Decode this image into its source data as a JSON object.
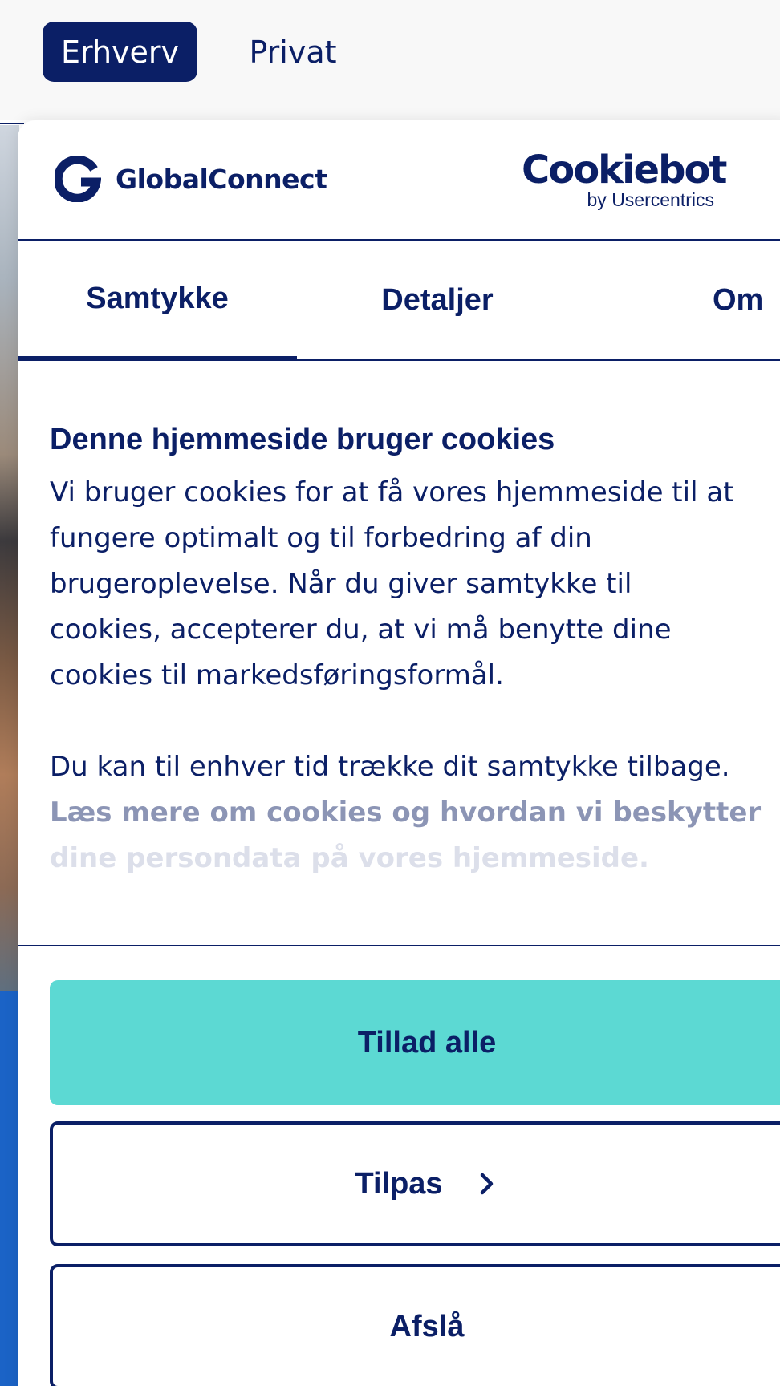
{
  "site_nav": {
    "segments": [
      {
        "label": "Erhverv",
        "active": true
      },
      {
        "label": "Privat",
        "active": false
      }
    ]
  },
  "dialog": {
    "brand_name": "GlobalConnect",
    "provider": {
      "name": "Cookiebot",
      "tagline": "by Usercentrics"
    },
    "tabs": [
      {
        "label": "Samtykke",
        "active": true
      },
      {
        "label": "Detaljer",
        "active": false
      },
      {
        "label": "Om",
        "active": false
      }
    ],
    "title": "Denne hjemmeside bruger cookies",
    "paragraph1_lines": [
      "Vi bruger cookies for at få vores hjemmeside til at",
      "fungere optimalt og til forbedring af din",
      "brugeroplevelse. Når du giver samtykke til",
      "cookies, accepterer du, at vi må benytte dine",
      "cookies til markedsføringsformål."
    ],
    "paragraph2_line": "Du kan til enhver tid trække dit samtykke tilbage.",
    "link_lines": [
      "Læs mere om cookies og hvordan vi beskytter",
      "dine persondata på vores hjemmeside."
    ],
    "buttons": {
      "allow_all": "Tillad alle",
      "customize": "Tilpas",
      "deny": "Afslå"
    }
  },
  "colors": {
    "brand_navy": "#0b1f66",
    "accent_teal": "#5cd9d3",
    "site_blue": "#1b63c6"
  },
  "icons": [
    "globalconnect-logo-icon",
    "chevron-right-icon"
  ]
}
